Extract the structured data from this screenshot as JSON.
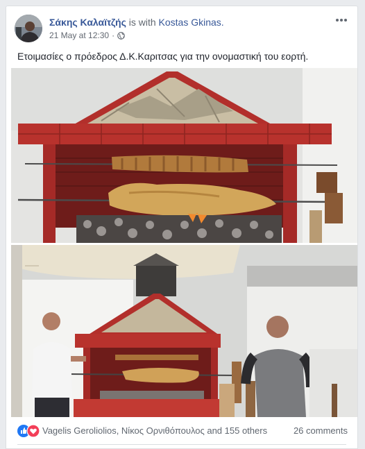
{
  "post": {
    "author": "Σάκης Καλαϊτζής",
    "with_text": "is with",
    "tagged": "Kostas Gkinas.",
    "date": "21 May at 12:30",
    "dot": "·",
    "audience_icon": "globe-icon",
    "caption": "Ετοιμασίες ο πρόεδρος Δ.Κ.Καριτσας για την ονομαστική του εορτή."
  },
  "footer": {
    "reaction_icons": [
      "like-icon",
      "love-icon"
    ],
    "likers": "Vagelis Geroliolios, Νίκος Ορνιθόπουλος and 155 others",
    "comments": "26 comments"
  },
  "colors": {
    "link": "#385898",
    "like": "#2078f4",
    "love": "#f33e58",
    "bbq_red": "#b0302c"
  }
}
